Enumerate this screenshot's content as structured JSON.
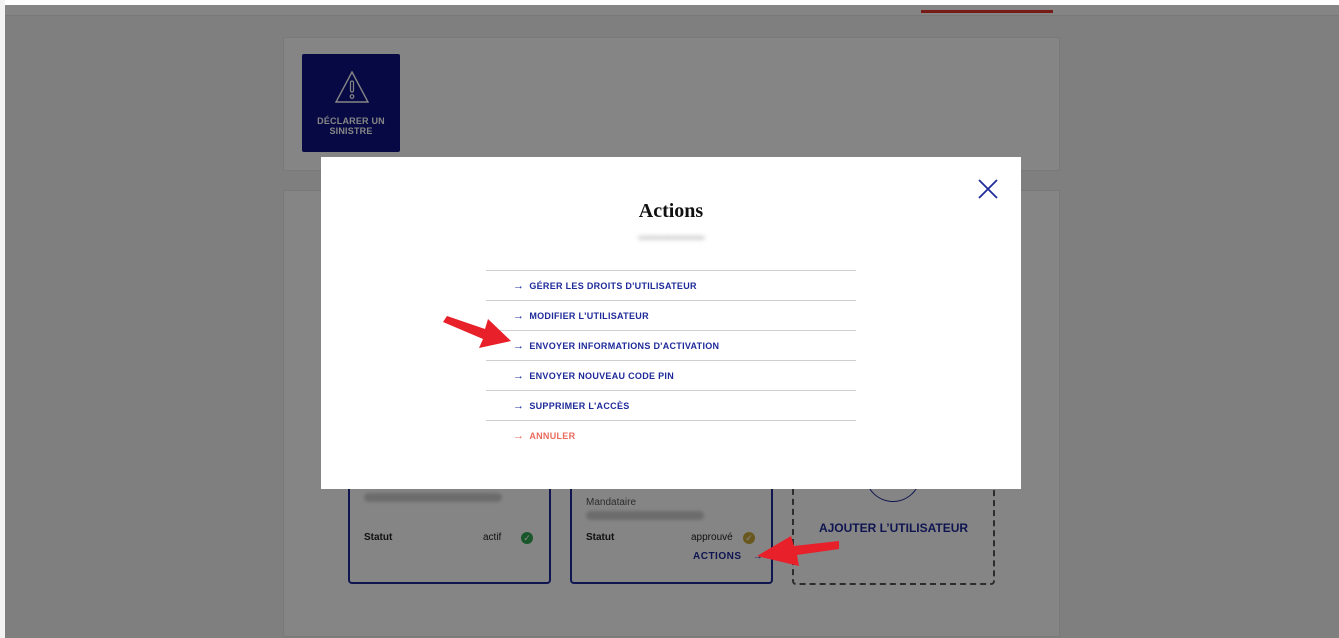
{
  "background": {
    "sinistre_tile": {
      "label": "DÉCLARER UN\nSINISTRE",
      "icon": "warning-icon"
    },
    "user_cards": [
      {
        "status_label": "Statut",
        "status_value": "actif",
        "status_color": "#2fa84f"
      },
      {
        "role": "Mandataire",
        "status_label": "Statut",
        "status_value": "approuvé",
        "status_color": "#c9a93a",
        "actions_label": "ACTIONS"
      }
    ],
    "add_user_label": "AJOUTER L’UTILISATEUR"
  },
  "modal": {
    "title": "Actions",
    "email": "•••••••••••••••••••••",
    "close_icon": "close-icon",
    "items": [
      {
        "label": "GÉRER LES DROITS D'UTILISATEUR"
      },
      {
        "label": "MODIFIER L'UTILISATEUR"
      },
      {
        "label": "ENVOYER INFORMATIONS D'ACTIVATION"
      },
      {
        "label": "ENVOYER NOUVEAU CODE PIN"
      },
      {
        "label": "SUPPRIMER L'ACCÈS"
      },
      {
        "label": "ANNULER"
      }
    ],
    "arrow_glyph": "→"
  },
  "colors": {
    "primary": "#1e2a9a",
    "cancel": "#e96b5c",
    "annotation": "#e8202a",
    "accent": "#e5342c"
  }
}
